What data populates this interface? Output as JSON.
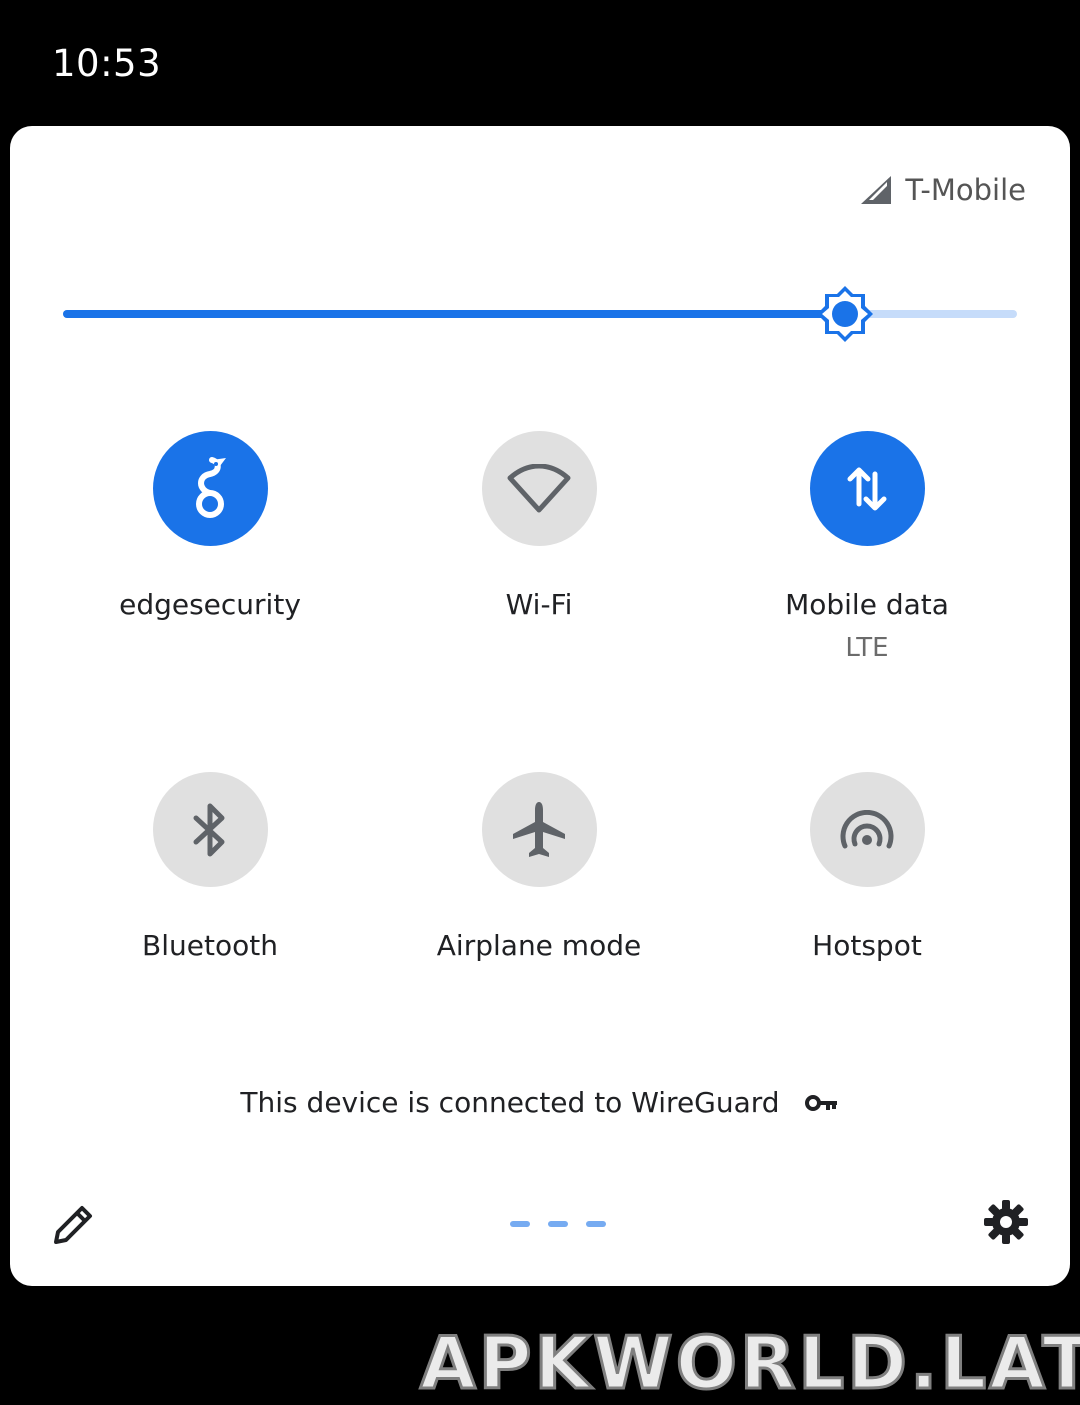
{
  "status_bar": {
    "time": "10:53"
  },
  "carrier": {
    "name": "T-Mobile",
    "icon": "signal-icon"
  },
  "brightness": {
    "level": 0.82,
    "accent": "#1a73e8",
    "track": "#c6dcfa"
  },
  "tiles": [
    {
      "label": "edgesecurity",
      "sub": "",
      "state": "on",
      "icon": "wireguard-dragon-icon"
    },
    {
      "label": "Wi-Fi",
      "sub": "",
      "state": "off",
      "icon": "wifi-icon"
    },
    {
      "label": "Mobile data",
      "sub": "LTE",
      "state": "on",
      "icon": "mobile-data-icon"
    },
    {
      "label": "Bluetooth",
      "sub": "",
      "state": "off",
      "icon": "bluetooth-icon"
    },
    {
      "label": "Airplane mode",
      "sub": "",
      "state": "off",
      "icon": "airplane-icon"
    },
    {
      "label": "Hotspot",
      "sub": "",
      "state": "off",
      "icon": "hotspot-icon"
    }
  ],
  "footer": {
    "vpn_message": "This device is connected to WireGuard",
    "icon": "key-icon"
  },
  "bottom_bar": {
    "edit_icon": "pencil-icon",
    "settings_icon": "gear-icon"
  },
  "watermark": "APKWORLD.LAT",
  "colors": {
    "on": "#1a73e8",
    "off": "#e0e0e0",
    "icon_off": "#5f6368"
  }
}
